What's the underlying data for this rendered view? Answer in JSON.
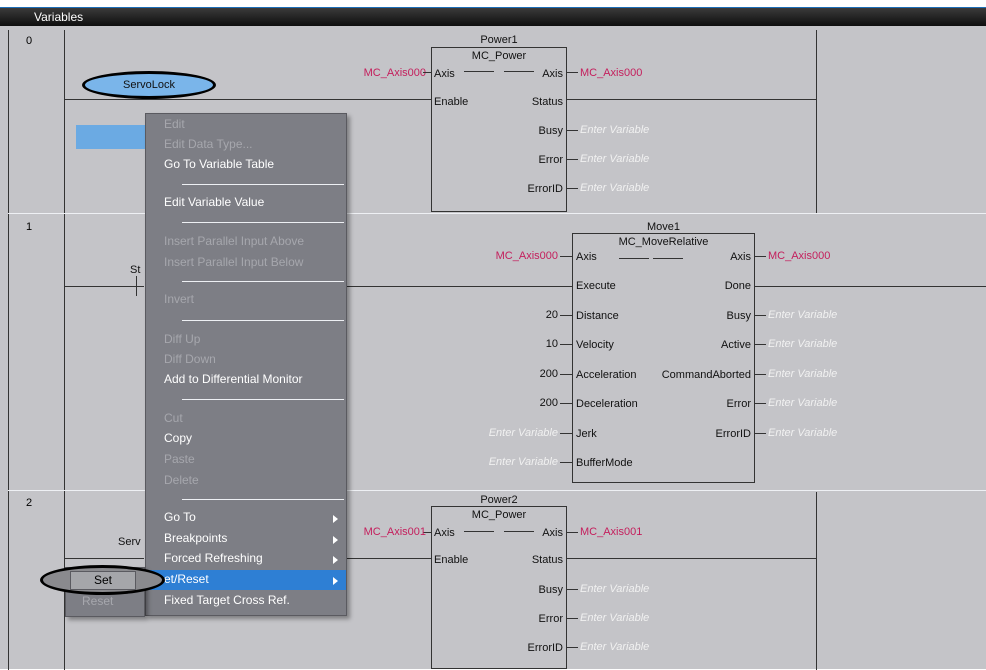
{
  "titlebar": {
    "title": "Variables"
  },
  "rungs": [
    {
      "number": "0"
    },
    {
      "number": "1"
    },
    {
      "number": "2"
    }
  ],
  "rung0": {
    "instance": "Power1",
    "fb_type": "MC_Power",
    "in_axis_var": "MC_Axis000",
    "in_axis": "Axis",
    "out_axis": "Axis",
    "out_axis_var": "MC_Axis000",
    "in_enable": "Enable",
    "out_status": "Status",
    "out_busy": "Busy",
    "out_error": "Error",
    "out_errorid": "ErrorID",
    "placeholder": "Enter Variable",
    "contact_label": "ServoLock"
  },
  "rung1": {
    "instance": "Move1",
    "fb_type": "MC_MoveRelative",
    "contact_label_partial": "St",
    "inputs": [
      {
        "value": "MC_Axis000",
        "pin": "Axis"
      },
      {
        "value": "",
        "pin": "Execute"
      },
      {
        "value": "20",
        "pin": "Distance"
      },
      {
        "value": "10",
        "pin": "Velocity"
      },
      {
        "value": "200",
        "pin": "Acceleration"
      },
      {
        "value": "200",
        "pin": "Deceleration"
      },
      {
        "value": "Enter Variable",
        "pin": "Jerk"
      },
      {
        "value": "Enter Variable",
        "pin": "BufferMode"
      }
    ],
    "outputs": [
      {
        "pin": "Axis",
        "value": "MC_Axis000"
      },
      {
        "pin": "Done",
        "value": ""
      },
      {
        "pin": "Busy",
        "value": "Enter Variable"
      },
      {
        "pin": "Active",
        "value": "Enter Variable"
      },
      {
        "pin": "CommandAborted",
        "value": "Enter Variable"
      },
      {
        "pin": "Error",
        "value": "Enter Variable"
      },
      {
        "pin": "ErrorID",
        "value": "Enter Variable"
      }
    ]
  },
  "rung2": {
    "instance": "Power2",
    "fb_type": "MC_Power",
    "contact_label_partial": "Serv",
    "in_axis_var": "MC_Axis001",
    "in_axis": "Axis",
    "out_axis": "Axis",
    "out_axis_var": "MC_Axis001",
    "in_enable": "Enable",
    "out_status": "Status",
    "out_busy": "Busy",
    "out_error": "Error",
    "out_errorid": "ErrorID",
    "placeholder": "Enter Variable"
  },
  "context_menu": {
    "items": [
      {
        "label": "Edit",
        "enabled": false
      },
      {
        "label": "Edit Data Type...",
        "enabled": false
      },
      {
        "label": "Go To Variable Table",
        "enabled": true
      },
      {
        "label": "Edit Variable Value",
        "enabled": true
      },
      {
        "label": "Insert Parallel Input Above",
        "enabled": false
      },
      {
        "label": "Insert Parallel Input Below",
        "enabled": false
      },
      {
        "label": "Invert",
        "enabled": false
      },
      {
        "label": "Diff Up",
        "enabled": false
      },
      {
        "label": "Diff Down",
        "enabled": false
      },
      {
        "label": "Add to Differential Monitor",
        "enabled": true
      },
      {
        "label": "Cut",
        "enabled": false
      },
      {
        "label": "Copy",
        "enabled": true
      },
      {
        "label": "Paste",
        "enabled": false
      },
      {
        "label": "Delete",
        "enabled": false
      },
      {
        "label": "Go To",
        "enabled": true,
        "submenu": true
      },
      {
        "label": "Breakpoints",
        "enabled": true,
        "submenu": true
      },
      {
        "label": "Forced Refreshing",
        "enabled": true,
        "submenu": true
      },
      {
        "label": "et/Reset",
        "enabled": true,
        "submenu": true,
        "highlighted": true
      },
      {
        "label": "Fixed Target Cross Ref.",
        "enabled": true
      }
    ]
  },
  "submenu": {
    "items": [
      {
        "label": "Set"
      },
      {
        "label": "Reset"
      }
    ]
  },
  "colors": {
    "canvas": "#c4c4c8",
    "menu_bg": "#7d7e85",
    "menu_highlight": "#2e7fd4",
    "variable_red": "#c41e5c",
    "selection_blue": "#6baae3"
  }
}
